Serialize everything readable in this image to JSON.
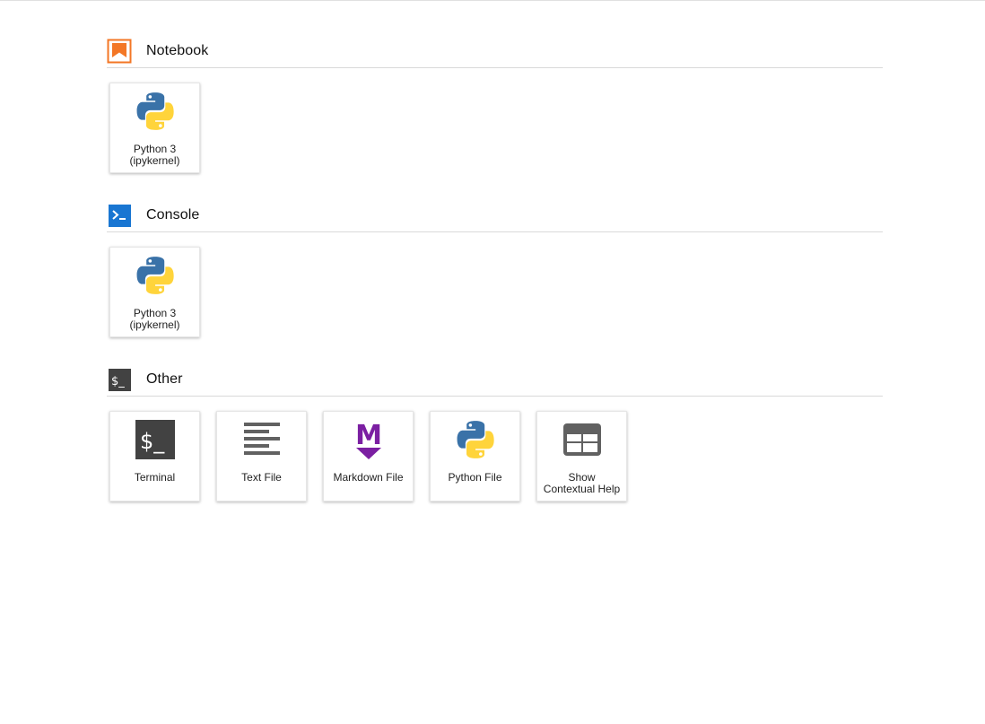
{
  "colors": {
    "notebook_accent": "#f37726",
    "console_accent": "#1976d2",
    "other_accent": "#424242",
    "markdown_purple": "#7b1fa2",
    "python_blue": "#3a72a8",
    "python_yellow": "#ffd43b"
  },
  "sections": [
    {
      "title": "Notebook",
      "icon": "notebook-bookmark-icon",
      "cards": [
        {
          "icon": "python-logo-icon",
          "line1": "Python 3",
          "line2": "(ipykernel)"
        }
      ]
    },
    {
      "title": "Console",
      "icon": "console-prompt-icon",
      "cards": [
        {
          "icon": "python-logo-icon",
          "line1": "Python 3",
          "line2": "(ipykernel)"
        }
      ]
    },
    {
      "title": "Other",
      "icon": "terminal-dollar-icon",
      "cards": [
        {
          "icon": "terminal-icon",
          "line1": "Terminal",
          "line2": ""
        },
        {
          "icon": "text-file-icon",
          "line1": "Text File",
          "line2": ""
        },
        {
          "icon": "markdown-icon",
          "line1": "Markdown File",
          "line2": ""
        },
        {
          "icon": "python-logo-icon",
          "line1": "Python File",
          "line2": ""
        },
        {
          "icon": "contextual-help-icon",
          "line1": "Show",
          "line2": "Contextual Help"
        }
      ]
    }
  ],
  "icon_glyphs": {
    "terminal_text": "$_",
    "markdown_letter": "M"
  }
}
